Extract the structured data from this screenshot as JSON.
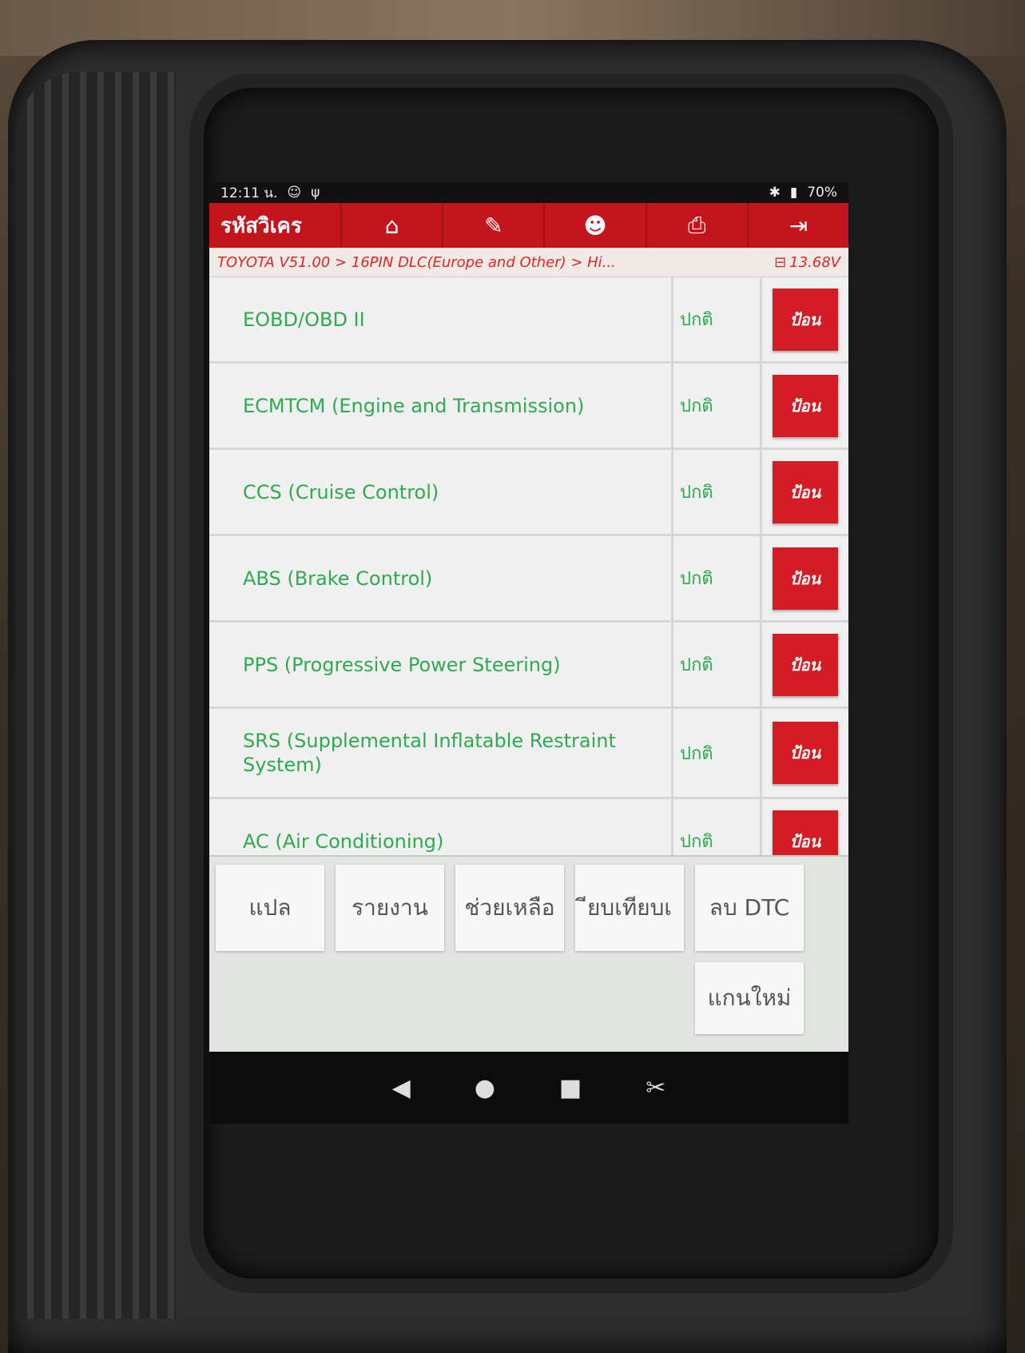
{
  "status_bar": {
    "time": "12:11 น.",
    "battery": "70%"
  },
  "toolbar": {
    "title": "รหัสวิเคร",
    "buttons": [
      "home-icon",
      "edit-icon",
      "person-icon",
      "print-icon",
      "exit-icon"
    ]
  },
  "breadcrumb": {
    "path": "TOYOTA V51.00 > 16PIN DLC(Europe and Other) > Hi...",
    "voltage": "13.68V"
  },
  "systems": [
    {
      "name": "EOBD/OBD II",
      "status": "ปกติ",
      "action": "ป้อน"
    },
    {
      "name": "ECMTCM (Engine and Transmission)",
      "status": "ปกติ",
      "action": "ป้อน"
    },
    {
      "name": "CCS (Cruise Control)",
      "status": "ปกติ",
      "action": "ป้อน"
    },
    {
      "name": "ABS (Brake Control)",
      "status": "ปกติ",
      "action": "ป้อน"
    },
    {
      "name": "PPS (Progressive Power Steering)",
      "status": "ปกติ",
      "action": "ป้อน"
    },
    {
      "name": "SRS (Supplemental Inflatable Restraint System)",
      "status": "ปกติ",
      "action": "ป้อน"
    },
    {
      "name": "AC (Air Conditioning)",
      "status": "ปกติ",
      "action": "ป้อน"
    }
  ],
  "bottom_buttons": {
    "translate": "แปล",
    "report": "รายงาน",
    "help": "ช่วยเหลือ",
    "compare": "ียบเทียบเ",
    "clear_dtc": "ลบ DTC",
    "rescan": "แกนใหม่"
  },
  "colors": {
    "accent_red": "#c4151c",
    "text_green": "#2eaa4f"
  }
}
